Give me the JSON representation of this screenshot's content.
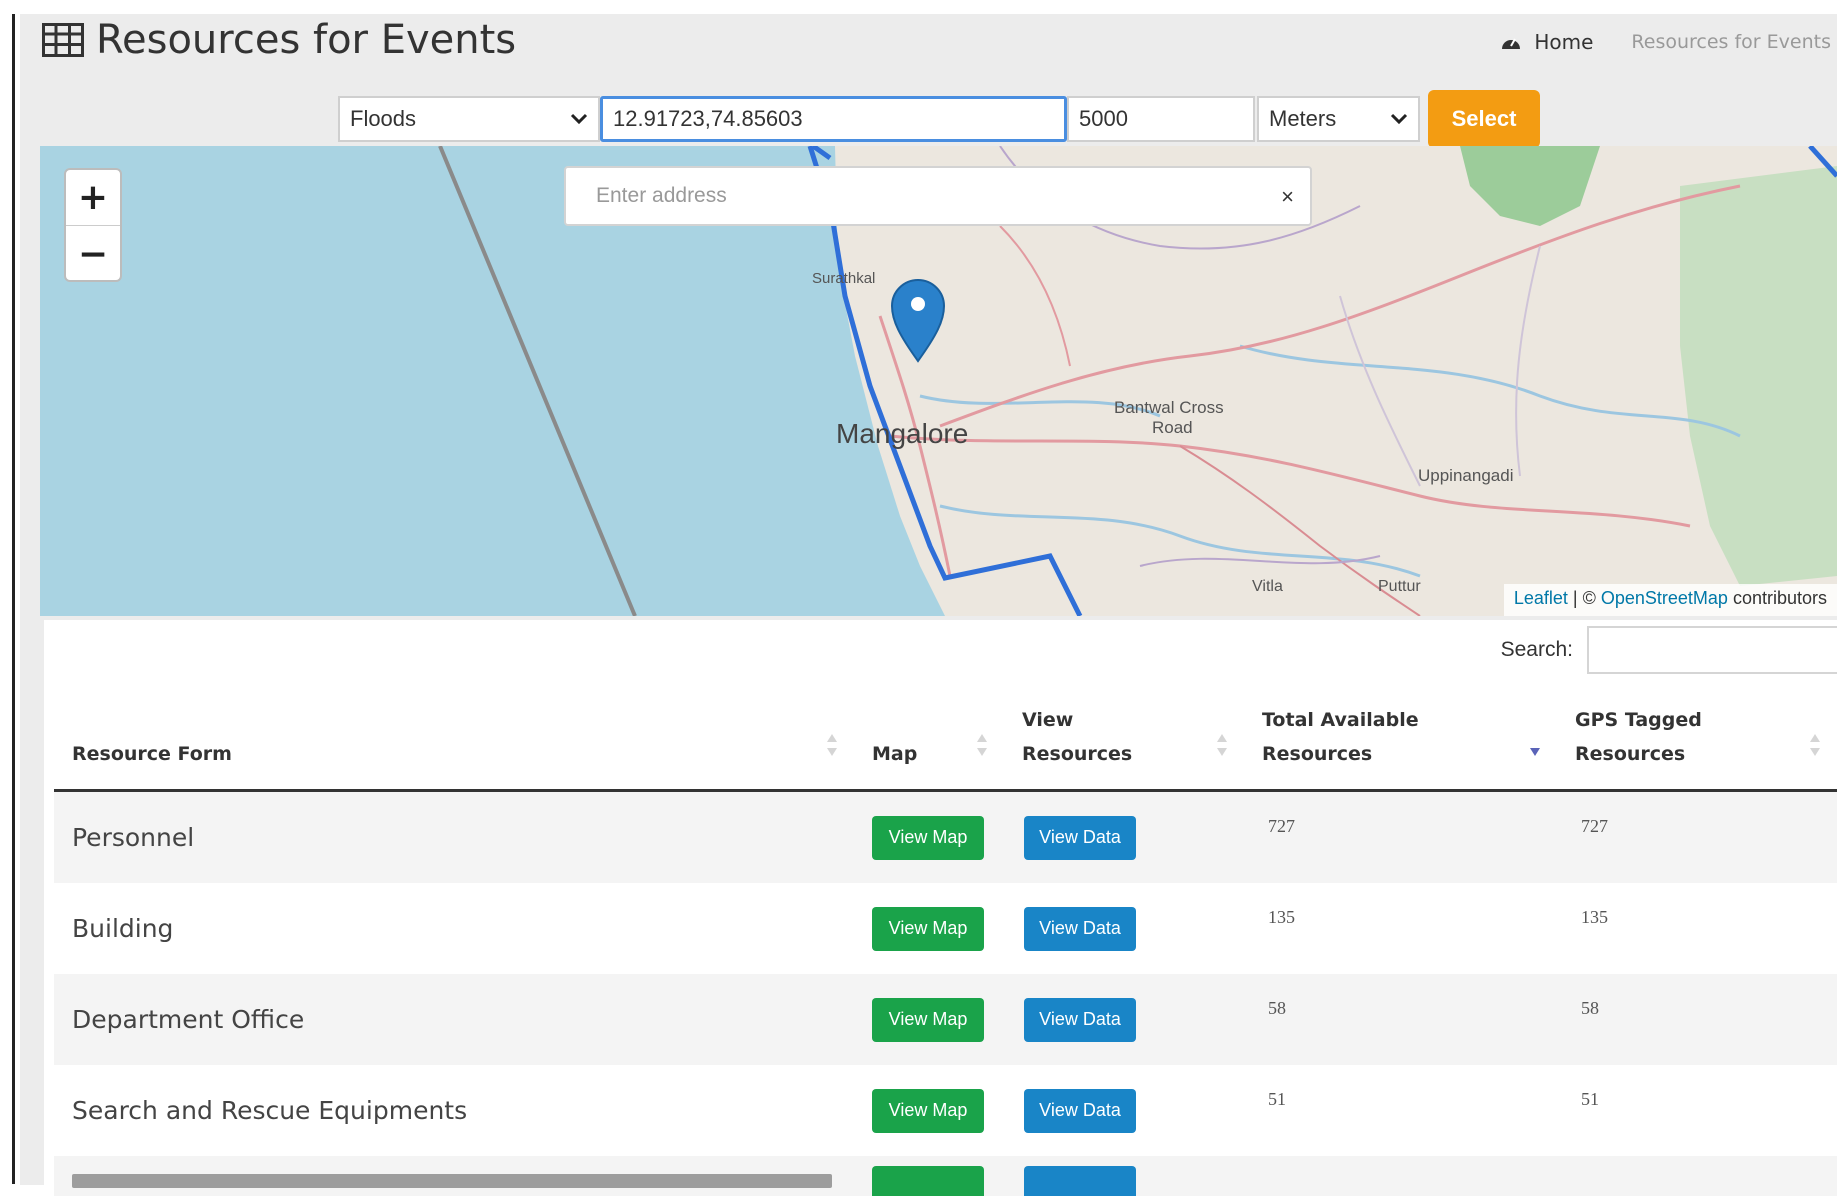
{
  "header": {
    "title": "Resources for Events",
    "breadcrumb_home": "Home",
    "breadcrumb_current": "Resources for Events"
  },
  "filters": {
    "event_type": "Floods",
    "coordinates": "12.91723,74.85603",
    "radius": "5000",
    "unit": "Meters",
    "submit_label": "Select"
  },
  "map": {
    "search_placeholder": "Enter address",
    "clear_label": "×",
    "zoom_in": "+",
    "zoom_out": "−",
    "labels": {
      "city": "Mangalore",
      "surathkal": "Surathkal",
      "bantwal": "Bantwal Cross",
      "road": "Road",
      "uppinangadi": "Uppinangadi",
      "vitla": "Vitla",
      "puttur": "Puttur"
    },
    "attribution_leaflet": "Leaflet",
    "attribution_sep": " | © ",
    "attribution_osm": "OpenStreetMap",
    "attribution_tail": " contributors"
  },
  "table": {
    "search_label": "Search:",
    "columns": {
      "resource_form": "Resource Form",
      "map": "Map",
      "view_line1": "View",
      "view_line2": "Resources",
      "total_line1": "Total Available",
      "total_line2": "Resources",
      "gps_line1": "GPS Tagged",
      "gps_line2": "Resources"
    },
    "view_map_label": "View Map",
    "view_data_label": "View Data",
    "rows": [
      {
        "form": "Personnel",
        "total": "727",
        "gps": "727"
      },
      {
        "form": "Building",
        "total": "135",
        "gps": "135"
      },
      {
        "form": "Department Office",
        "total": "58",
        "gps": "58"
      },
      {
        "form": "Search and Rescue Equipments",
        "total": "51",
        "gps": "51"
      }
    ]
  },
  "colors": {
    "submit": "#f39c12",
    "view_map": "#1aa34a",
    "view_data": "#1985c7",
    "marker": "#2a81cb",
    "boundary": "#2f6fd8"
  }
}
